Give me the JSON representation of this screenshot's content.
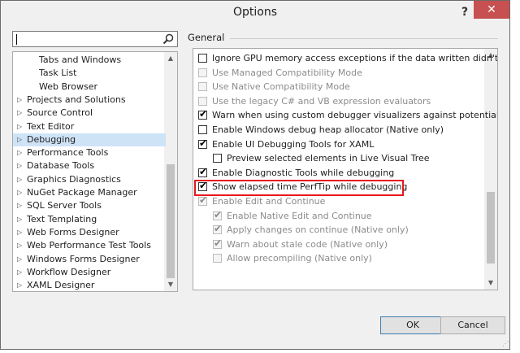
{
  "window": {
    "title": "Options",
    "help": "?",
    "close": "✕"
  },
  "tree": {
    "items": [
      {
        "label": "Tabs and Windows",
        "indent": 2,
        "arrow": ""
      },
      {
        "label": "Task List",
        "indent": 2,
        "arrow": ""
      },
      {
        "label": "Web Browser",
        "indent": 2,
        "arrow": ""
      },
      {
        "label": "Projects and Solutions",
        "indent": 1,
        "arrow": "▷"
      },
      {
        "label": "Source Control",
        "indent": 1,
        "arrow": "▷"
      },
      {
        "label": "Text Editor",
        "indent": 1,
        "arrow": "▷"
      },
      {
        "label": "Debugging",
        "indent": 1,
        "arrow": "▷",
        "selected": true
      },
      {
        "label": "Performance Tools",
        "indent": 1,
        "arrow": "▷"
      },
      {
        "label": "Database Tools",
        "indent": 1,
        "arrow": "▷"
      },
      {
        "label": "Graphics Diagnostics",
        "indent": 1,
        "arrow": "▷"
      },
      {
        "label": "NuGet Package Manager",
        "indent": 1,
        "arrow": "▷"
      },
      {
        "label": "SQL Server Tools",
        "indent": 1,
        "arrow": "▷"
      },
      {
        "label": "Text Templating",
        "indent": 1,
        "arrow": "▷"
      },
      {
        "label": "Web Forms Designer",
        "indent": 1,
        "arrow": "▷"
      },
      {
        "label": "Web Performance Test Tools",
        "indent": 1,
        "arrow": "▷"
      },
      {
        "label": "Windows Forms Designer",
        "indent": 1,
        "arrow": "▷"
      },
      {
        "label": "Workflow Designer",
        "indent": 1,
        "arrow": "▷"
      },
      {
        "label": "XAML Designer",
        "indent": 1,
        "arrow": "▷"
      }
    ]
  },
  "section": {
    "title": "General"
  },
  "options": [
    {
      "label": "Ignore GPU memory access exceptions if the data written didn't cha",
      "checked": false,
      "disabled": false,
      "level": 0
    },
    {
      "label": "Use Managed Compatibility Mode",
      "checked": false,
      "disabled": true,
      "level": 0
    },
    {
      "label": "Use Native Compatibility Mode",
      "checked": false,
      "disabled": true,
      "level": 0
    },
    {
      "label": "Use the legacy C# and VB expression evaluators",
      "checked": false,
      "disabled": true,
      "level": 0
    },
    {
      "label": "Warn when using custom debugger visualizers against potentially uns",
      "checked": true,
      "disabled": false,
      "level": 0
    },
    {
      "label": "Enable Windows debug heap allocator (Native only)",
      "checked": false,
      "disabled": false,
      "level": 0
    },
    {
      "label": "Enable UI Debugging Tools for XAML",
      "checked": true,
      "disabled": false,
      "level": 0
    },
    {
      "label": "Preview selected elements in Live Visual Tree",
      "checked": false,
      "disabled": false,
      "level": 1
    },
    {
      "label": "Enable Diagnostic Tools while debugging",
      "checked": true,
      "disabled": false,
      "level": 0
    },
    {
      "label": "Show elapsed time PerfTip while debugging",
      "checked": true,
      "disabled": false,
      "level": 0
    },
    {
      "label": "Enable Edit and Continue",
      "checked": true,
      "disabled": true,
      "level": 0
    },
    {
      "label": "Enable Native Edit and Continue",
      "checked": true,
      "disabled": true,
      "level": 1
    },
    {
      "label": "Apply changes on continue (Native only)",
      "checked": true,
      "disabled": true,
      "level": 1
    },
    {
      "label": "Warn about stale code (Native only)",
      "checked": true,
      "disabled": true,
      "level": 1
    },
    {
      "label": "Allow precompiling (Native only)",
      "checked": false,
      "disabled": true,
      "level": 1
    }
  ],
  "buttons": {
    "ok": "OK",
    "cancel": "Cancel"
  },
  "colors": {
    "highlight": "#e8161e",
    "selection": "#cfe3f7",
    "close": "#c75050"
  }
}
